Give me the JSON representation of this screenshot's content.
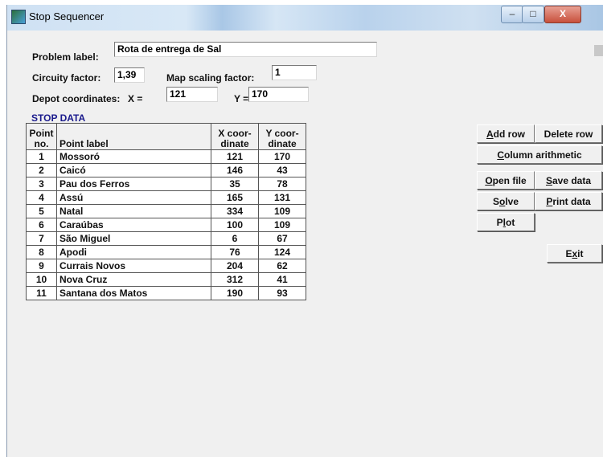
{
  "window": {
    "title": "Stop Sequencer",
    "minimize": "–",
    "maximize": "□",
    "close": "X"
  },
  "problem": {
    "problem_label_caption": "Problem label:",
    "problem_label_value": "Rota de entrega de Sal",
    "circuity_caption": "Circuity factor:",
    "circuity_value": "1,39",
    "map_scaling_caption": "Map scaling factor:",
    "map_scaling_value": "1",
    "depot_caption": "Depot coordinates:",
    "x_caption": "X =",
    "x_value": "121",
    "y_caption": "Y =",
    "y_value": "170"
  },
  "stop_data_title": "STOP DATA",
  "table": {
    "headers": {
      "no_line1": "Point",
      "no_line2": "no.",
      "label": "Point label",
      "x_line1": "X coor-",
      "x_line2": "dinate",
      "y_line1": "Y coor-",
      "y_line2": "dinate"
    },
    "rows": [
      {
        "no": "1",
        "label": "Mossoró",
        "x": "121",
        "y": "170"
      },
      {
        "no": "2",
        "label": "Caicó",
        "x": "146",
        "y": "43"
      },
      {
        "no": "3",
        "label": "Pau dos Ferros",
        "x": "35",
        "y": "78"
      },
      {
        "no": "4",
        "label": "Assú",
        "x": "165",
        "y": "131"
      },
      {
        "no": "5",
        "label": "Natal",
        "x": "334",
        "y": "109"
      },
      {
        "no": "6",
        "label": "Caraúbas",
        "x": "100",
        "y": "109"
      },
      {
        "no": "7",
        "label": "São Miguel",
        "x": "6",
        "y": "67"
      },
      {
        "no": "8",
        "label": "Apodi",
        "x": "76",
        "y": "124"
      },
      {
        "no": "9",
        "label": "Currais Novos",
        "x": "204",
        "y": "62"
      },
      {
        "no": "10",
        "label": "Nova Cruz",
        "x": "312",
        "y": "41"
      },
      {
        "no": "11",
        "label": "Santana dos Matos",
        "x": "190",
        "y": "93"
      }
    ]
  },
  "buttons": {
    "add_row": {
      "u": "A",
      "rest": "dd row"
    },
    "delete_row": {
      "pre": "",
      "u": "",
      "rest": "Delete row"
    },
    "column_arithmetic": {
      "u": "C",
      "rest": "olumn arithmetic"
    },
    "open_file": {
      "u": "O",
      "rest": "pen file"
    },
    "save_data": {
      "u": "S",
      "rest": "ave data"
    },
    "solve": {
      "pre": "S",
      "u": "o",
      "rest": "lve"
    },
    "print_data": {
      "u": "P",
      "rest": "rint data"
    },
    "plot": {
      "pre": "P",
      "u": "l",
      "rest": "ot"
    },
    "exit": {
      "pre": "E",
      "u": "x",
      "rest": "it"
    }
  }
}
